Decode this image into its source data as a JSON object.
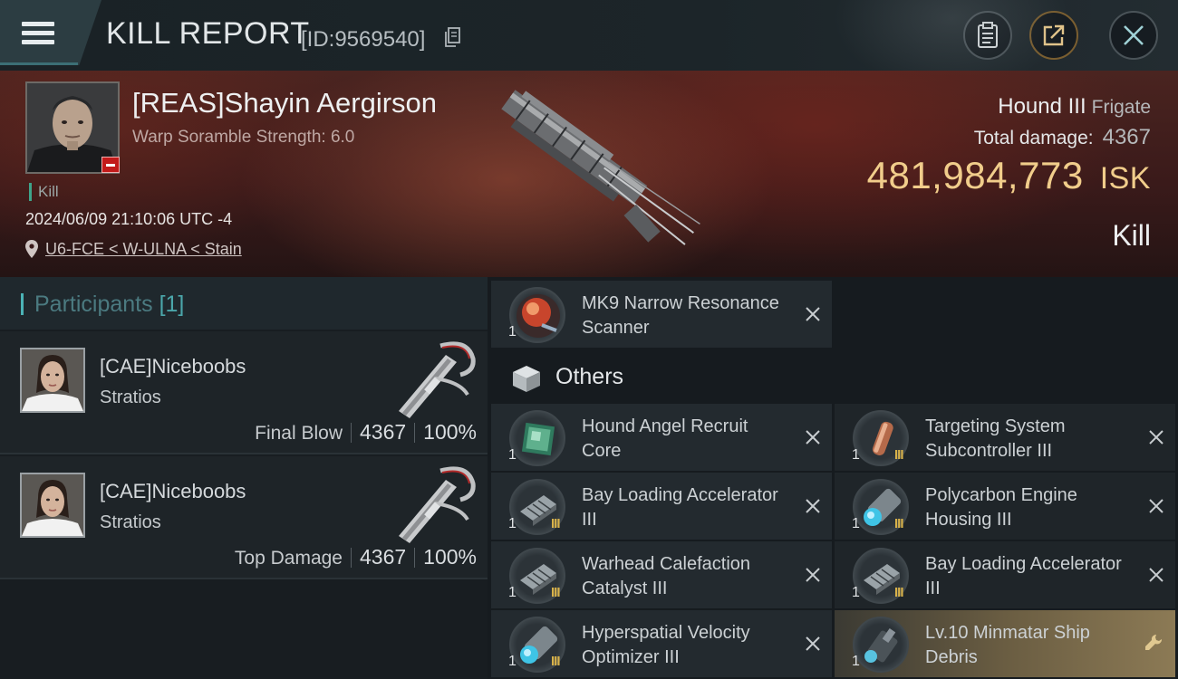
{
  "header": {
    "title": "KILL REPORT",
    "report_id": "[ID:9569540]",
    "icons": [
      "menu-icon",
      "copy-icon",
      "clipboard-icon",
      "share-icon",
      "close-icon"
    ]
  },
  "victim": {
    "name": "[REAS]Shayin Aergirson",
    "scramble": "Warp Soramble Strength: 6.0",
    "kill_tag": "Kill",
    "datetime": "2024/06/09 21:10:06 UTC -4",
    "location": "U6-FCE < W-ULNA < Stain",
    "ship_name": "Hound III",
    "ship_class": "Frigate",
    "total_damage_label": "Total damage:",
    "total_damage_value": "4367",
    "isk_value": "481,984,773",
    "isk_unit": "ISK",
    "result": "Kill"
  },
  "participants": {
    "label": "Participants",
    "count": "[1]",
    "rows": [
      {
        "name": "[CAE]Niceboobs",
        "ship": "Stratios",
        "role": "Final Blow",
        "damage": "4367",
        "percent": "100%"
      },
      {
        "name": "[CAE]Niceboobs",
        "ship": "Stratios",
        "role": "Top Damage",
        "damage": "4367",
        "percent": "100%"
      }
    ]
  },
  "items": {
    "top": {
      "name": "MK9 Narrow Resonance Scanner",
      "qty": "1",
      "meta": "",
      "icon": "scanner-icon"
    },
    "others_label": "Others",
    "list": [
      {
        "name": "Hound Angel Recruit Core",
        "qty": "1",
        "meta": "",
        "icon": "core-icon"
      },
      {
        "name": "Targeting System Subcontroller III",
        "qty": "1",
        "meta": "III",
        "icon": "subcontroller-icon"
      },
      {
        "name": "Bay Loading Accelerator III",
        "qty": "1",
        "meta": "III",
        "icon": "launcher-rig-icon"
      },
      {
        "name": "Polycarbon Engine Housing III",
        "qty": "1",
        "meta": "III",
        "icon": "engine-rig-icon"
      },
      {
        "name": "Warhead Calefaction Catalyst III",
        "qty": "1",
        "meta": "III",
        "icon": "launcher-rig-icon"
      },
      {
        "name": "Bay Loading Accelerator III",
        "qty": "1",
        "meta": "III",
        "icon": "launcher-rig-icon"
      },
      {
        "name": "Hyperspatial Velocity Optimizer III",
        "qty": "1",
        "meta": "III",
        "icon": "engine-rig-icon"
      },
      {
        "name": "Lv.10 Minmatar Ship Debris",
        "qty": "1",
        "meta": "",
        "icon": "debris-icon"
      }
    ]
  },
  "colors": {
    "isk": "#f1cd8b",
    "accent_teal": "#4bb3b6",
    "danger_red": "#c21a1a",
    "tech3_gold": "#d8b24a"
  }
}
